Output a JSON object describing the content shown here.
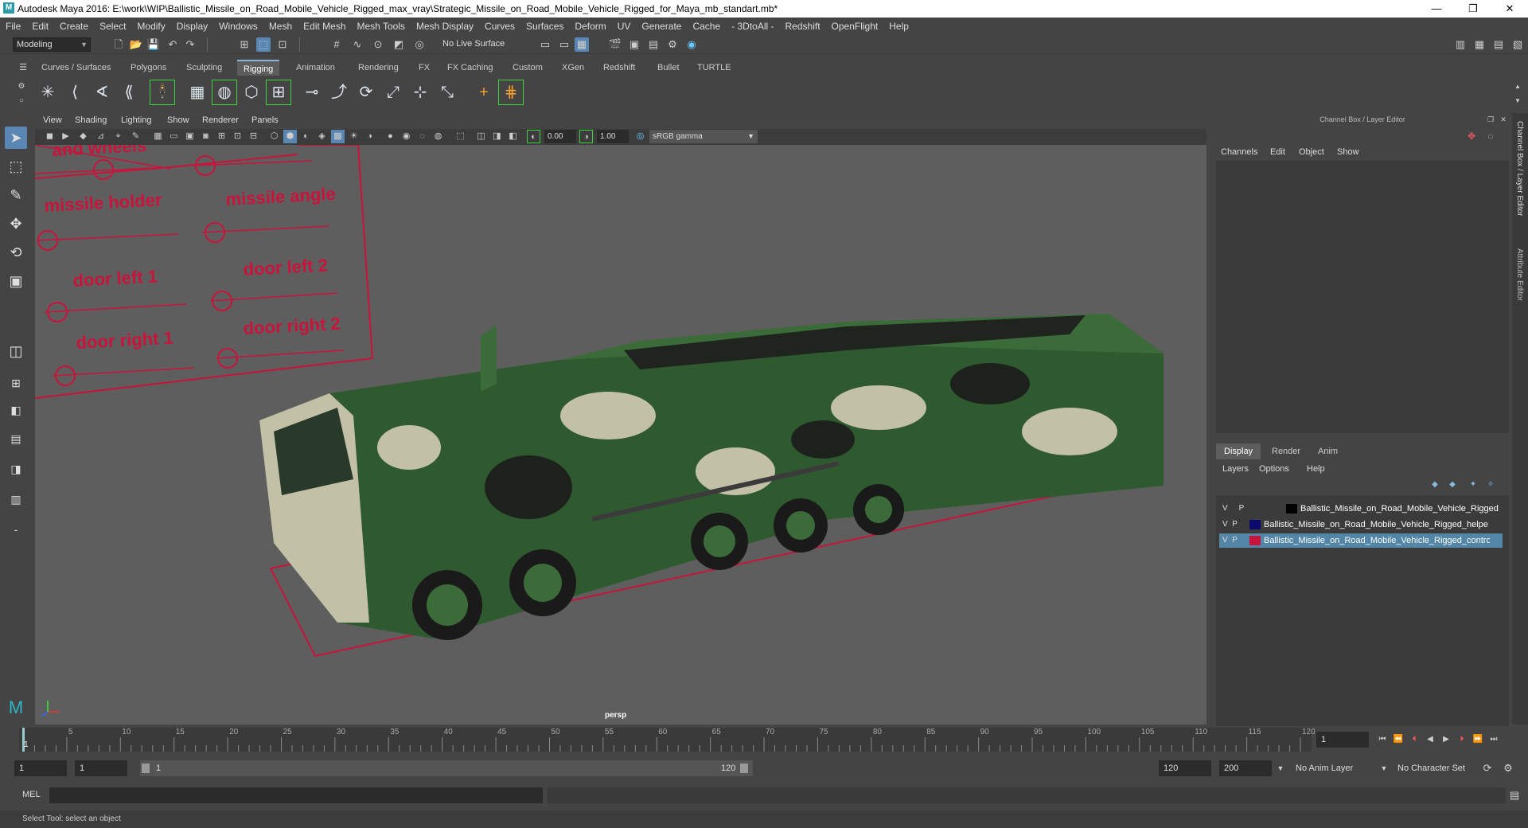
{
  "window": {
    "title": "Autodesk Maya 2016: E:\\work\\WIP\\Ballistic_Missile_on_Road_Mobile_Vehicle_Rigged_max_vray\\Strategic_Missile_on_Road_Mobile_Vehicle_Rigged_for_Maya_mb_standart.mb*",
    "minimize": "—",
    "restore": "❐",
    "close": "✕"
  },
  "menubar": [
    "File",
    "Edit",
    "Create",
    "Select",
    "Modify",
    "Display",
    "Windows",
    "Mesh",
    "Edit Mesh",
    "Mesh Tools",
    "Mesh Display",
    "Curves",
    "Surfaces",
    "Deform",
    "UV",
    "Generate",
    "Cache",
    "- 3DtoAll -",
    "Redshift",
    "OpenFlight",
    "Help"
  ],
  "status": {
    "mode": "Modeling",
    "live_surface": "No Live Surface"
  },
  "shelf_tabs": [
    "Curves / Surfaces",
    "Polygons",
    "Sculpting",
    "Rigging",
    "Animation",
    "Rendering",
    "FX",
    "FX Caching",
    "Custom",
    "XGen",
    "Redshift",
    "Bullet",
    "TURTLE"
  ],
  "active_shelf": "Rigging",
  "viewport_menu": [
    "View",
    "Shading",
    "Lighting",
    "Show",
    "Renderer",
    "Panels"
  ],
  "viewport_fields": {
    "exposure": "0.00",
    "gamma": "1.00",
    "color_space": "sRGB gamma"
  },
  "viewport_label": "persp",
  "control_labels": [
    "and wheels",
    "missile holder",
    "missile angle",
    "door left 1",
    "door left 2",
    "door right 1",
    "door right 2"
  ],
  "right_panel": {
    "title": "Channel Box / Layer Editor",
    "channel_menu": [
      "Channels",
      "Edit",
      "Object",
      "Show"
    ],
    "layer_tabs": [
      "Display",
      "Render",
      "Anim"
    ],
    "active_layer_tab": "Display",
    "layer_menu": [
      "Layers",
      "Options",
      "Help"
    ],
    "layers": [
      {
        "v": "V",
        "p": "P",
        "color": "#000000",
        "name": "Ballistic_Missile_on_Road_Mobile_Vehicle_Rigged",
        "selected": false
      },
      {
        "v": "V",
        "p": "P",
        "color": "#0a0a6e",
        "name": "Ballistic_Missile_on_Road_Mobile_Vehicle_Rigged_helpe",
        "selected": false
      },
      {
        "v": "V",
        "p": "P",
        "color": "#c8143c",
        "name": "Ballistic_Missile_on_Road_Mobile_Vehicle_Rigged_contro",
        "selected": true
      }
    ],
    "side_tabs": [
      "Channel Box / Layer Editor",
      "Attribute Editor"
    ]
  },
  "timeline": {
    "labels": [
      "5",
      "10",
      "15",
      "20",
      "25",
      "30",
      "35",
      "40",
      "45",
      "50",
      "55",
      "60",
      "65",
      "70",
      "75",
      "80",
      "85",
      "90",
      "95",
      "100",
      "105",
      "110",
      "115",
      "120"
    ],
    "start_marker": "1",
    "current_frame": "1"
  },
  "range": {
    "start": "1",
    "playback_start": "1",
    "slider_start": "1",
    "slider_end": "120",
    "playback_end": "120",
    "end": "200",
    "anim_layer": "No Anim Layer",
    "character_set": "No Character Set"
  },
  "mel": {
    "label": "MEL"
  },
  "help_line": "Select Tool: select an object",
  "colors": {
    "accent": "#5a86b3",
    "control_red": "#c8143c",
    "selection": "#5285a6"
  }
}
